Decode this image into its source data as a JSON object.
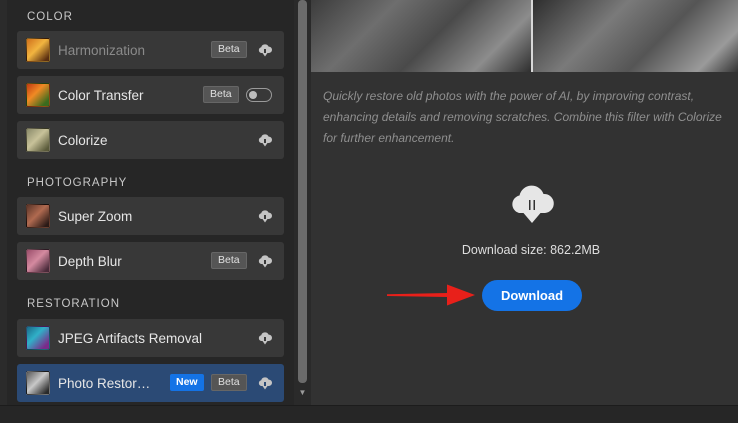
{
  "sections": {
    "color": "COLOR",
    "photography": "PHOTOGRAPHY",
    "restoration": "RESTORATION"
  },
  "filters": [
    {
      "label": "Harmonization",
      "badge": "Beta",
      "action": "download-cloud",
      "dimmed": true
    },
    {
      "label": "Color Transfer",
      "badge": "Beta",
      "action": "toggle",
      "toggle_on": false
    },
    {
      "label": "Colorize",
      "action": "download-cloud"
    },
    {
      "label": "Super Zoom",
      "action": "download-cloud"
    },
    {
      "label": "Depth Blur",
      "badge": "Beta",
      "action": "download-cloud"
    },
    {
      "label": "JPEG Artifacts Removal",
      "action": "download-cloud"
    },
    {
      "label": "Photo Restor…",
      "badges": [
        "New",
        "Beta"
      ],
      "action": "download-cloud",
      "selected": true
    }
  ],
  "main": {
    "description": "Quickly restore old photos with the power of AI, by improving contrast, enhancing details and removing scratches. Combine this filter with Colorize for further enhancement.",
    "download_size": "Download size: 862.2MB",
    "download_label": "Download"
  },
  "icons": {
    "cloud_download": "cloud-download-icon",
    "annotation_arrow": "red-arrow-icon"
  },
  "colors": {
    "accent": "#1473e6",
    "selected_row": "#2b4a75",
    "arrow": "#e8201a"
  }
}
